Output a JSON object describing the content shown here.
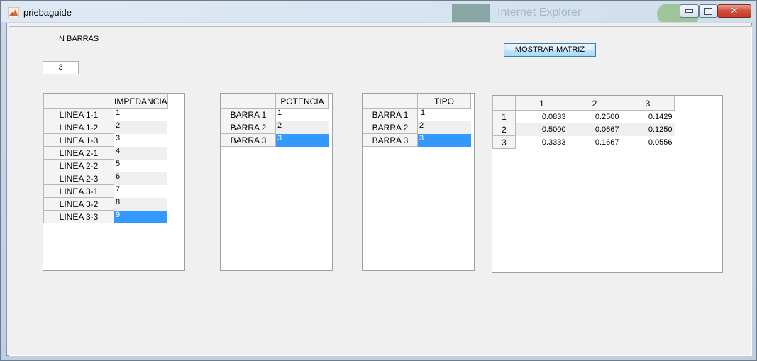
{
  "window": {
    "title": "priebaguide"
  },
  "background_hint": "Internet Explorer",
  "nbarras": {
    "label": "N BARRAS",
    "value": "3"
  },
  "button": {
    "label": "MOSTRAR MATRIZ"
  },
  "impedancia": {
    "header": "IMPEDANCIA",
    "rows": [
      {
        "label": "LINEA 1-1",
        "value": "1"
      },
      {
        "label": "LINEA 1-2",
        "value": "2"
      },
      {
        "label": "LINEA 1-3",
        "value": "3"
      },
      {
        "label": "LINEA 2-1",
        "value": "4"
      },
      {
        "label": "LINEA 2-2",
        "value": "5"
      },
      {
        "label": "LINEA 2-3",
        "value": "6"
      },
      {
        "label": "LINEA 3-1",
        "value": "7"
      },
      {
        "label": "LINEA 3-2",
        "value": "8"
      },
      {
        "label": "LINEA 3-3",
        "value": "9"
      }
    ]
  },
  "potencia": {
    "header": "POTENCIA",
    "rows": [
      {
        "label": "BARRA 1",
        "value": "1"
      },
      {
        "label": "BARRA 2",
        "value": "2"
      },
      {
        "label": "BARRA 3",
        "value": "3"
      }
    ]
  },
  "tipo": {
    "header": "TIPO",
    "rows": [
      {
        "label": "BARRA 1",
        "value": "1"
      },
      {
        "label": "BARRA 2",
        "value": "2"
      },
      {
        "label": "BARRA 3",
        "value": "3"
      }
    ]
  },
  "matriz": {
    "columns": [
      "1",
      "2",
      "3"
    ],
    "rows": [
      {
        "label": "1",
        "values": [
          "0.0833",
          "0.2500",
          "0.1429"
        ]
      },
      {
        "label": "2",
        "values": [
          "0.5000",
          "0.0667",
          "0.1250"
        ]
      },
      {
        "label": "3",
        "values": [
          "0.3333",
          "0.1667",
          "0.0556"
        ]
      }
    ]
  },
  "colors": {
    "selection": "#3399ff",
    "close_button": "#c43b27"
  },
  "icons": [
    "matlab-icon",
    "minimize-icon",
    "maximize-icon",
    "close-icon"
  ]
}
